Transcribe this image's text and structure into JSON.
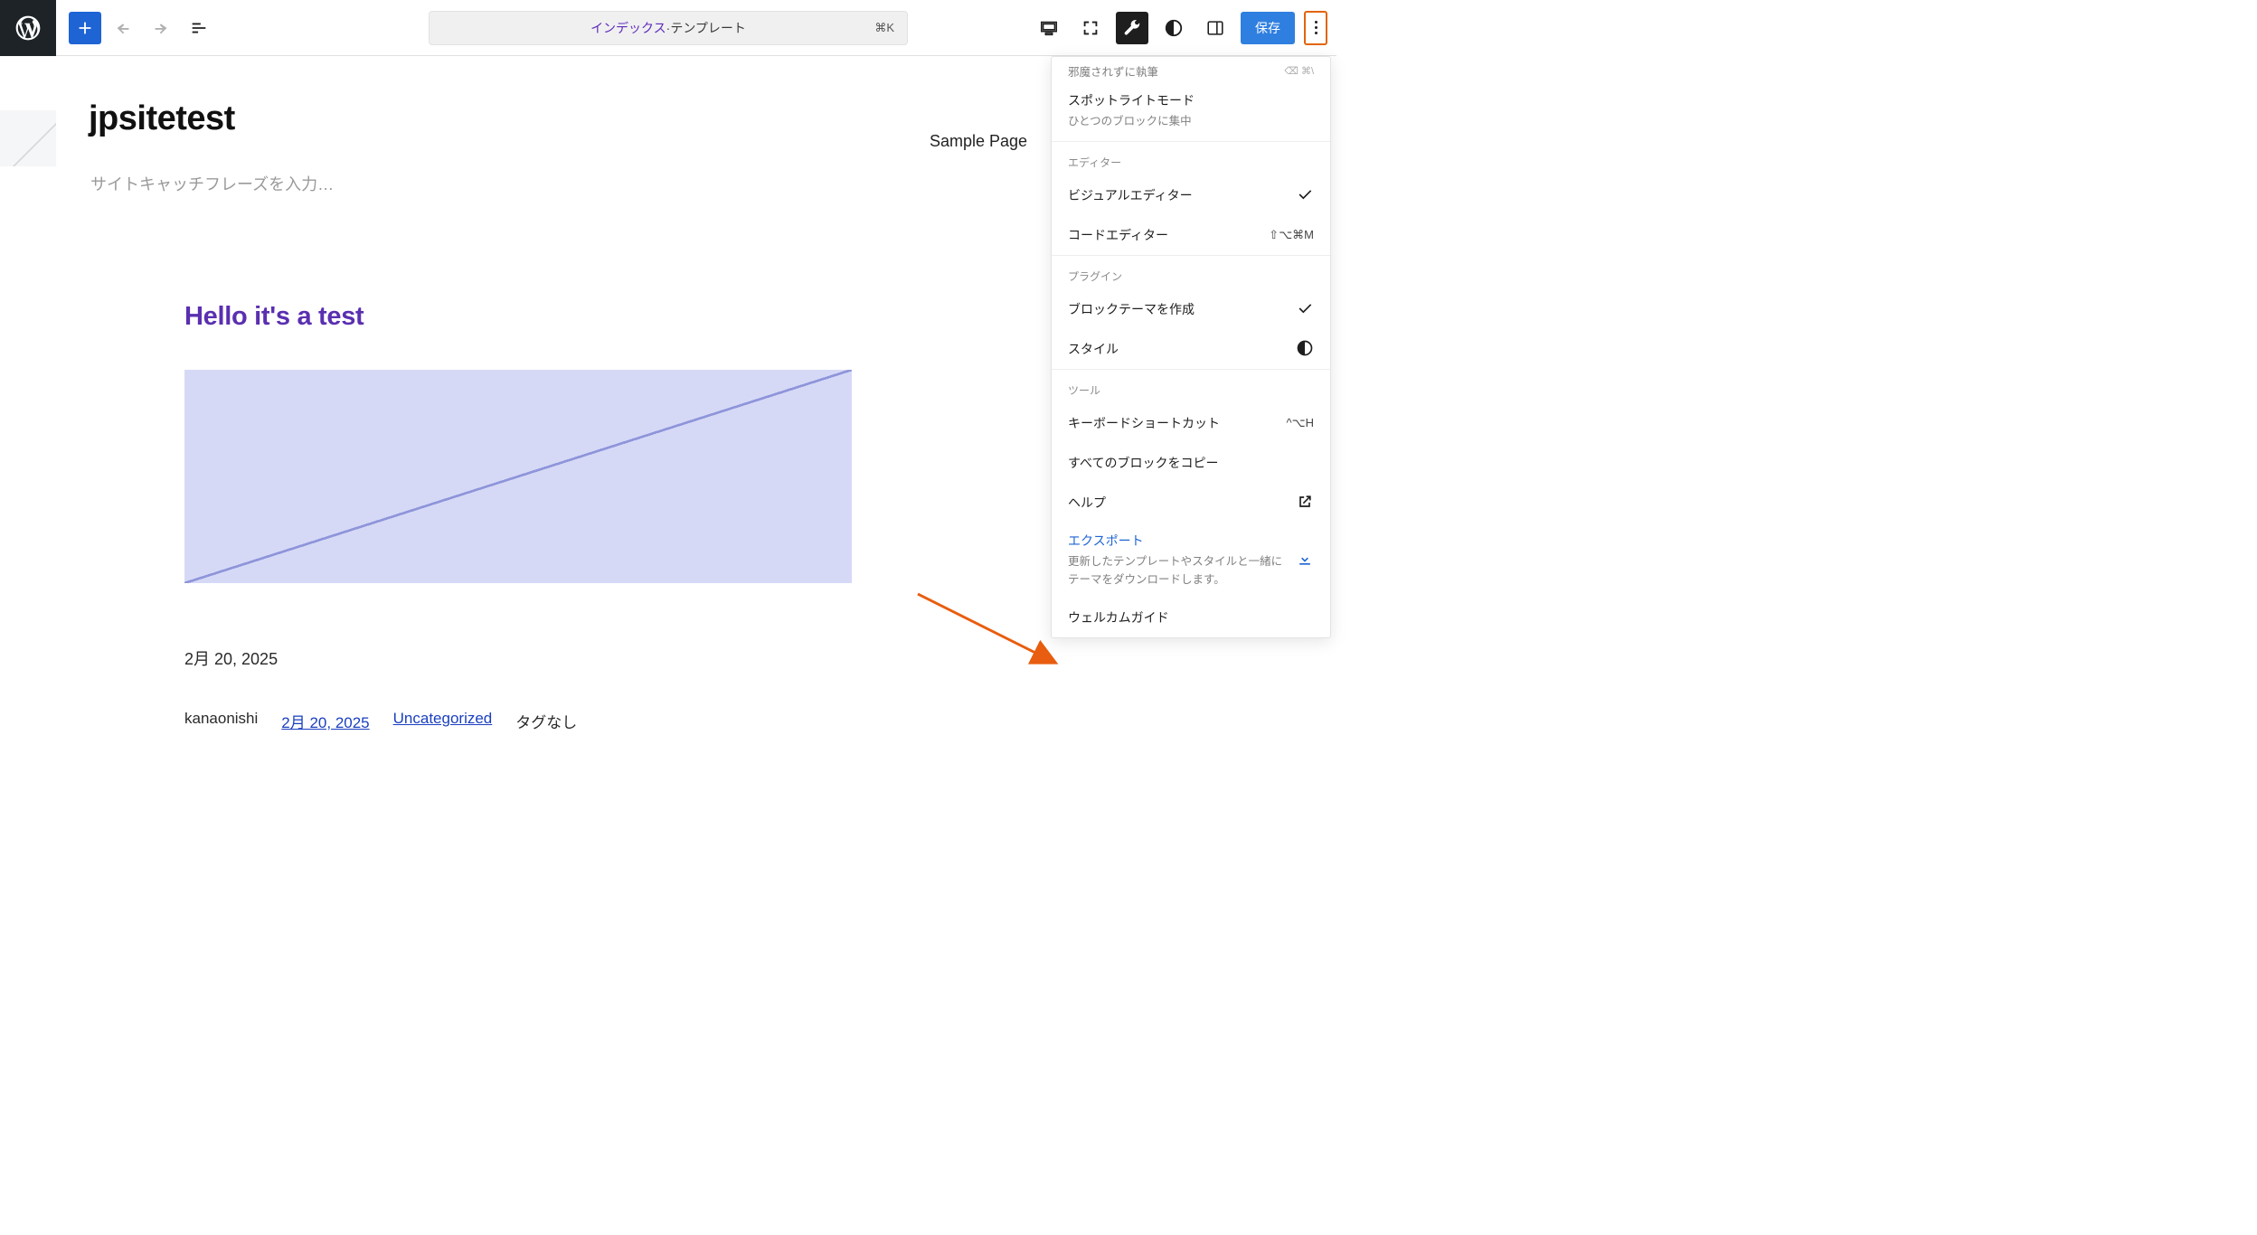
{
  "commandbar": {
    "index": "インデックス",
    "separator": " · ",
    "template": "テンプレート",
    "shortcut": "⌘K"
  },
  "toolbar": {
    "save": "保存"
  },
  "site": {
    "title": "jpsitetest",
    "tagline_placeholder": "サイトキャッチフレーズを入力…",
    "nav_sample": "Sample Page"
  },
  "post": {
    "title": "Hello it's a test",
    "date": "2月 20, 2025",
    "author": "kanaonishi",
    "date_link": "2月 20, 2025",
    "category": "Uncategorized",
    "tags_none": "タグなし"
  },
  "dropdown": {
    "distraction_free": {
      "label": "邪魔されずに執筆",
      "shortcut_partial": "⌫ ⌘\\"
    },
    "spotlight": {
      "label": "スポットライトモード",
      "desc": "ひとつのブロックに集中"
    },
    "group_editor": "エディター",
    "visual_editor": "ビジュアルエディター",
    "code_editor": {
      "label": "コードエディター",
      "shortcut": "⇧⌥⌘M"
    },
    "group_plugin": "プラグイン",
    "create_block_theme": "ブロックテーマを作成",
    "style": "スタイル",
    "group_tools": "ツール",
    "keyboard_shortcuts": {
      "label": "キーボードショートカット",
      "shortcut": "^⌥H"
    },
    "copy_all_blocks": "すべてのブロックをコピー",
    "help": "ヘルプ",
    "export": {
      "label": "エクスポート",
      "desc": "更新したテンプレートやスタイルと一緒にテーマをダウンロードします。"
    },
    "welcome_guide": "ウェルカムガイド"
  }
}
